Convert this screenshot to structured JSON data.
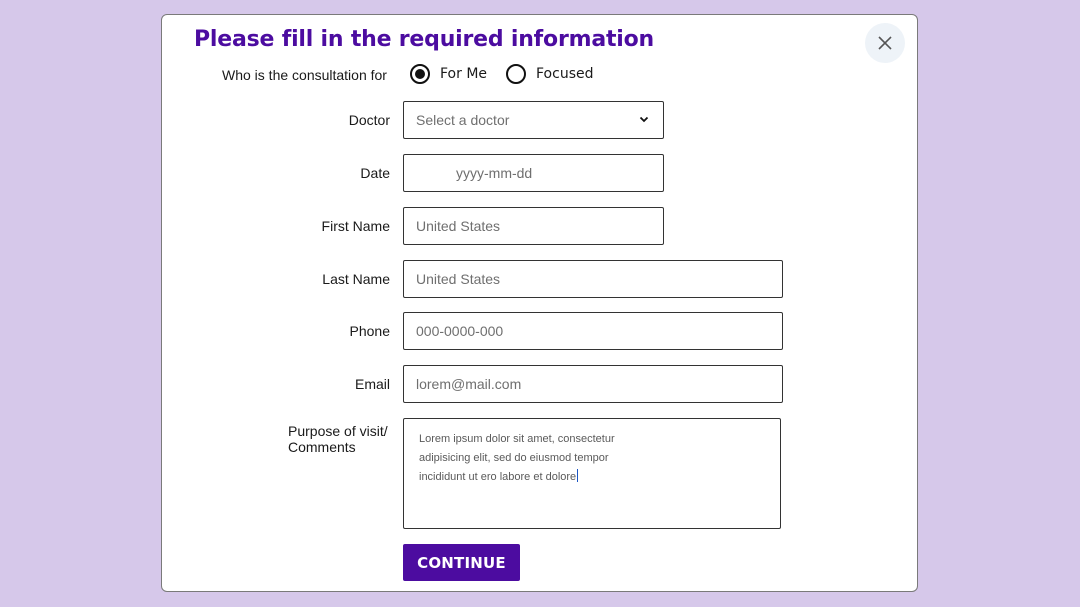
{
  "modal": {
    "title": "Please fill in the required information",
    "close_icon": "close-icon"
  },
  "consultation": {
    "label": "Who is the consultation for",
    "options": [
      {
        "label": "For Me",
        "selected": true
      },
      {
        "label": "Focused",
        "selected": false
      }
    ]
  },
  "form": {
    "doctor": {
      "label": "Doctor",
      "placeholder": "Select a doctor",
      "icon": "chevron-down-icon"
    },
    "date": {
      "label": "Date",
      "placeholder": "yyyy-mm-dd"
    },
    "first_name": {
      "label": "First Name",
      "placeholder": "United States"
    },
    "last_name": {
      "label": "Last Name",
      "placeholder": "United States"
    },
    "phone": {
      "label": "Phone",
      "placeholder": "000-0000-000"
    },
    "email": {
      "label": "Email",
      "placeholder": "lorem@mail.com"
    },
    "comments": {
      "label_line1": "Purpose of visit/",
      "label_line2": "Comments",
      "lines": [
        "Lorem ipsum dolor sit amet, consectetur",
        "adipisicing elit, sed do eiusmod tempor",
        "incididunt ut ero labore et dolore"
      ]
    }
  },
  "actions": {
    "continue_label": "CONTINUE"
  },
  "colors": {
    "background": "#d6c8ea",
    "accent": "#4c0ca0",
    "close_bg": "#eef3f8"
  }
}
